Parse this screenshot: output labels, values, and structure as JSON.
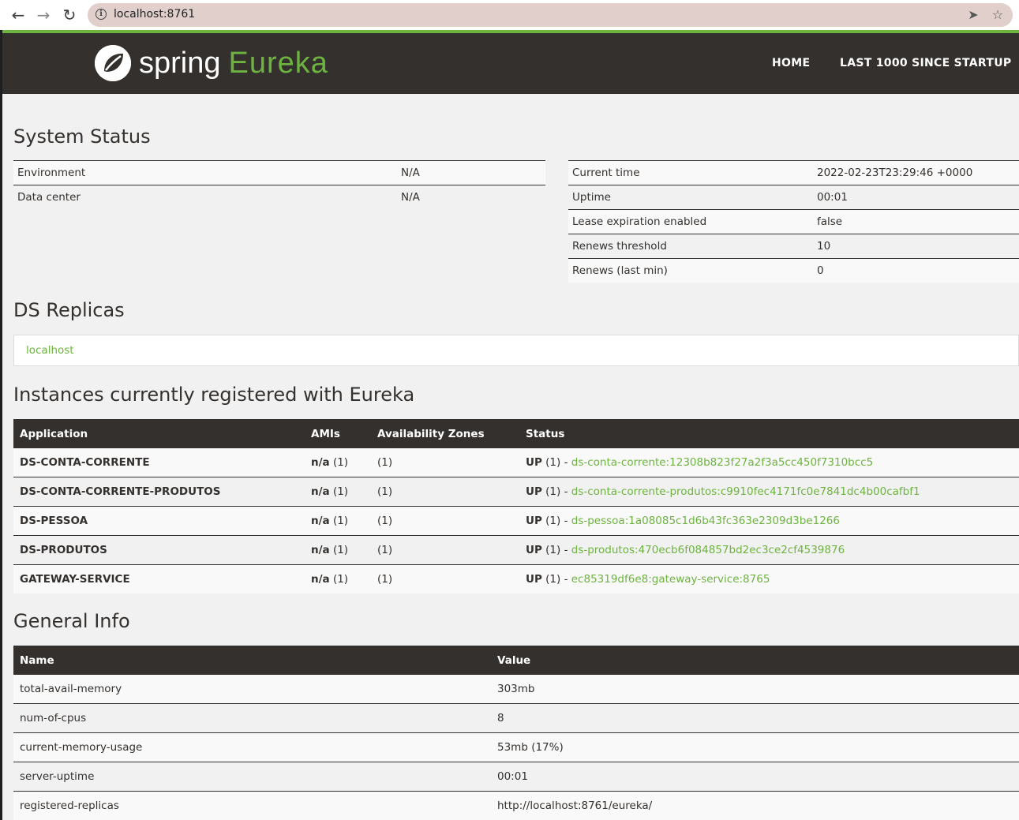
{
  "browser": {
    "url": "localhost:8761"
  },
  "navbar": {
    "brand_word1": "spring",
    "brand_word2": "Eureka",
    "links": [
      "HOME",
      "LAST 1000 SINCE STARTUP"
    ]
  },
  "system_status": {
    "title": "System Status",
    "left": [
      {
        "key": "Environment",
        "value": "N/A"
      },
      {
        "key": "Data center",
        "value": "N/A"
      }
    ],
    "right": [
      {
        "key": "Current time",
        "value": "2022-02-23T23:29:46 +0000"
      },
      {
        "key": "Uptime",
        "value": "00:01"
      },
      {
        "key": "Lease expiration enabled",
        "value": "false"
      },
      {
        "key": "Renews threshold",
        "value": "10"
      },
      {
        "key": "Renews (last min)",
        "value": "0"
      }
    ]
  },
  "ds_replicas": {
    "title": "DS Replicas",
    "items": [
      "localhost"
    ]
  },
  "instances": {
    "title": "Instances currently registered with Eureka",
    "headers": [
      "Application",
      "AMIs",
      "Availability Zones",
      "Status"
    ],
    "rows": [
      {
        "app": "DS-CONTA-CORRENTE",
        "ami_bold": "n/a",
        "ami_count": "(1)",
        "zones": "(1)",
        "status_bold": "UP",
        "status_count": "(1) -",
        "instance": "ds-conta-corrente:12308b823f27a2f3a5cc450f7310bcc5"
      },
      {
        "app": "DS-CONTA-CORRENTE-PRODUTOS",
        "ami_bold": "n/a",
        "ami_count": "(1)",
        "zones": "(1)",
        "status_bold": "UP",
        "status_count": "(1) -",
        "instance": "ds-conta-corrente-produtos:c9910fec4171fc0e7841dc4b00cafbf1"
      },
      {
        "app": "DS-PESSOA",
        "ami_bold": "n/a",
        "ami_count": "(1)",
        "zones": "(1)",
        "status_bold": "UP",
        "status_count": "(1) -",
        "instance": "ds-pessoa:1a08085c1d6b43fc363e2309d3be1266"
      },
      {
        "app": "DS-PRODUTOS",
        "ami_bold": "n/a",
        "ami_count": "(1)",
        "zones": "(1)",
        "status_bold": "UP",
        "status_count": "(1) -",
        "instance": "ds-produtos:470ecb6f084857bd2ec3ce2cf4539876"
      },
      {
        "app": "GATEWAY-SERVICE",
        "ami_bold": "n/a",
        "ami_count": "(1)",
        "zones": "(1)",
        "status_bold": "UP",
        "status_count": "(1) -",
        "instance": "ec85319df6e8:gateway-service:8765"
      }
    ]
  },
  "general_info": {
    "title": "General Info",
    "headers": [
      "Name",
      "Value"
    ],
    "rows": [
      {
        "name": "total-avail-memory",
        "value": "303mb"
      },
      {
        "name": "num-of-cpus",
        "value": "8"
      },
      {
        "name": "current-memory-usage",
        "value": "53mb (17%)"
      },
      {
        "name": "server-uptime",
        "value": "00:01"
      },
      {
        "name": "registered-replicas",
        "value": "http://localhost:8761/eureka/"
      }
    ]
  },
  "colors": {
    "navbar_bg": "#34302d",
    "accent_green": "#6db33f",
    "content_bg": "#f1f1f1"
  },
  "icons": [
    "back-arrow-icon",
    "forward-arrow-icon",
    "reload-icon",
    "info-icon",
    "send-icon",
    "bookmark-star-icon",
    "spring-leaf-icon"
  ]
}
